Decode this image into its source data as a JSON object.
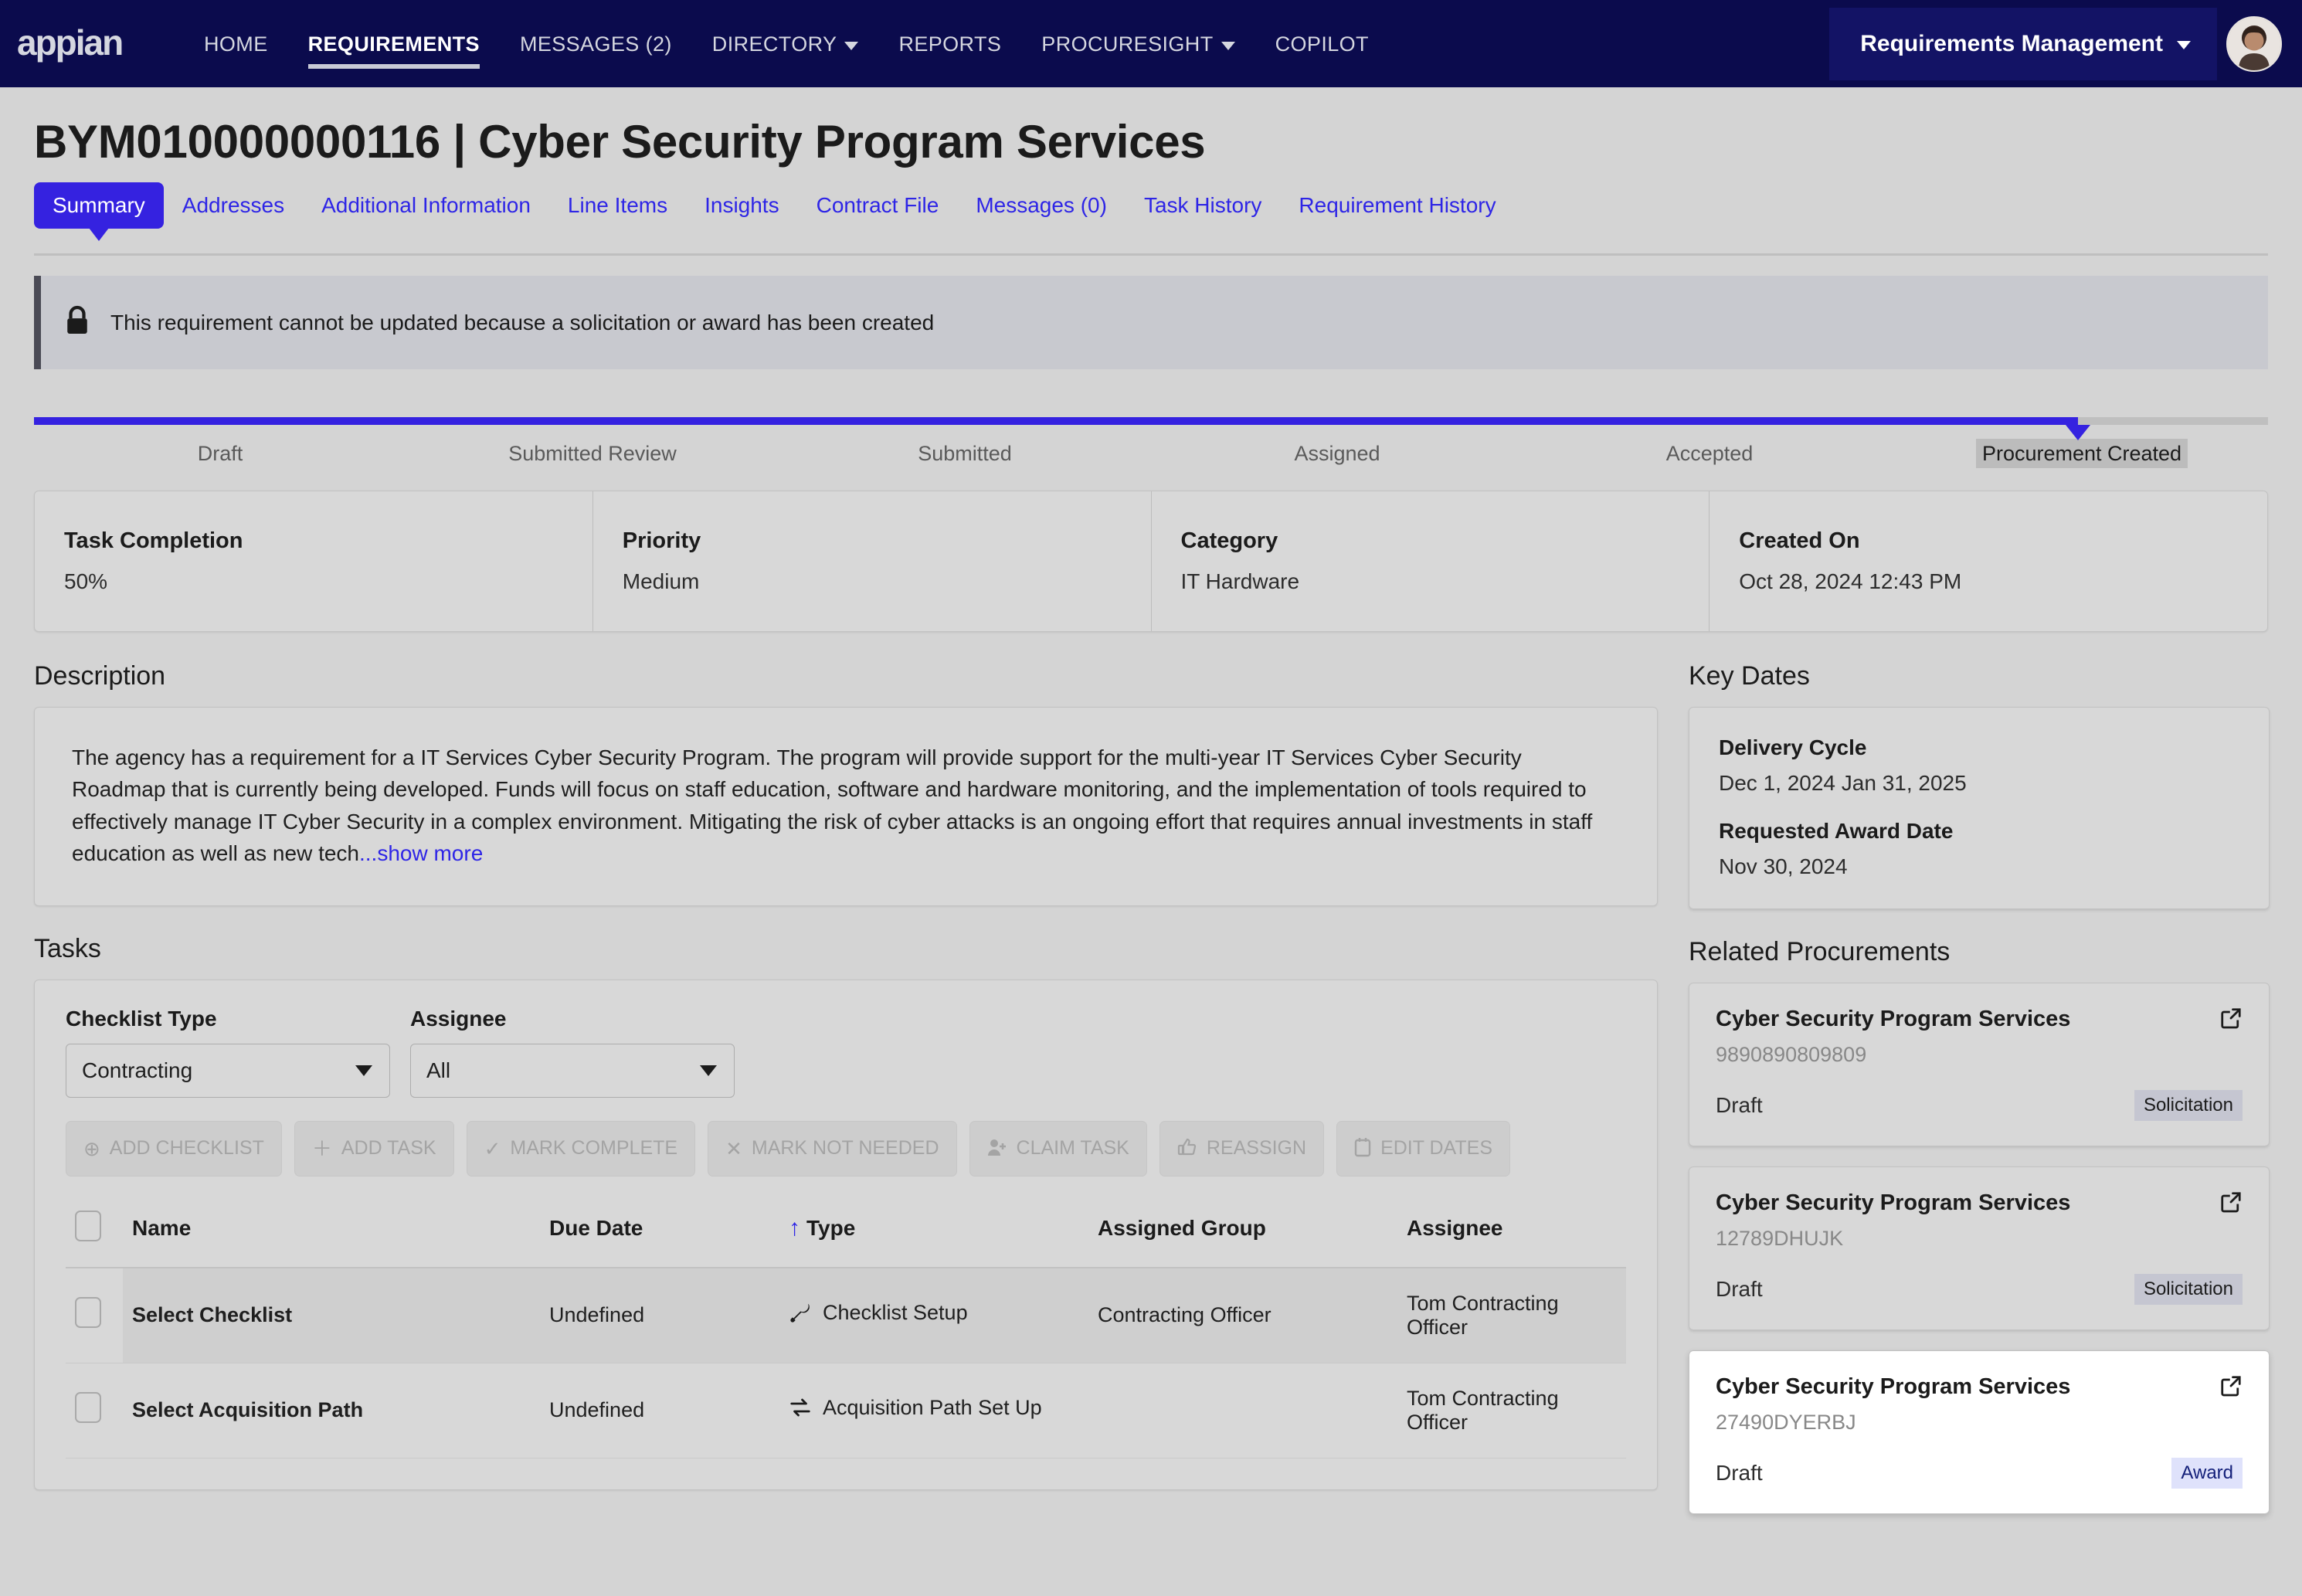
{
  "topnav": {
    "logo_alt": "appian",
    "items": [
      {
        "label": "HOME",
        "has_caret": false,
        "active": false
      },
      {
        "label": "REQUIREMENTS",
        "has_caret": false,
        "active": true
      },
      {
        "label": "MESSAGES (2)",
        "has_caret": false,
        "active": false
      },
      {
        "label": "DIRECTORY",
        "has_caret": true,
        "active": false
      },
      {
        "label": "REPORTS",
        "has_caret": false,
        "active": false
      },
      {
        "label": "PROCURESIGHT",
        "has_caret": true,
        "active": false
      },
      {
        "label": "COPILOT",
        "has_caret": false,
        "active": false
      }
    ],
    "app_switcher": "Requirements Management"
  },
  "page": {
    "title": "BYM010000000116 | Cyber Security Program Services"
  },
  "tabs": [
    {
      "label": "Summary",
      "active": true
    },
    {
      "label": "Addresses",
      "active": false
    },
    {
      "label": "Additional Information",
      "active": false
    },
    {
      "label": "Line Items",
      "active": false
    },
    {
      "label": "Insights",
      "active": false
    },
    {
      "label": "Contract File",
      "active": false
    },
    {
      "label": "Messages (0)",
      "active": false
    },
    {
      "label": "Task History",
      "active": false
    },
    {
      "label": "Requirement History",
      "active": false
    }
  ],
  "alert": {
    "icon": "lock-icon",
    "message": "This requirement cannot be updated because a solicitation or award has been created"
  },
  "progress": {
    "steps": [
      "Draft",
      "Submitted Review",
      "Submitted",
      "Assigned",
      "Accepted",
      "Procurement Created"
    ],
    "current_index": 5,
    "fill_percent": 91.5,
    "accent": "#3522e0"
  },
  "stats": [
    {
      "label": "Task Completion",
      "value": "50%"
    },
    {
      "label": "Priority",
      "value": "Medium"
    },
    {
      "label": "Category",
      "value": "IT Hardware"
    },
    {
      "label": "Created On",
      "value": "Oct 28, 2024 12:43 PM"
    }
  ],
  "description": {
    "heading": "Description",
    "body": "The agency has a requirement for a IT Services Cyber Security Program. The program will provide support for the multi-year IT Services Cyber Security Roadmap that is currently being developed. Funds will focus on staff education, software and hardware monitoring, and the implementation of tools required to effectively manage IT Cyber Security in a complex environment. Mitigating the risk of cyber attacks is an ongoing effort that requires annual investments in staff education as well as new tech",
    "show_more": "...show more"
  },
  "tasks": {
    "heading": "Tasks",
    "checklist_type": {
      "label": "Checklist Type",
      "value": "Contracting"
    },
    "assignee_filter": {
      "label": "Assignee",
      "value": "All"
    },
    "buttons": [
      {
        "label": "ADD CHECKLIST",
        "icon": "plus-circle-icon",
        "glyph": "⊕"
      },
      {
        "label": "ADD TASK",
        "icon": "plus-icon",
        "glyph": "＋"
      },
      {
        "label": "MARK COMPLETE",
        "icon": "check-icon",
        "glyph": "✓"
      },
      {
        "label": "MARK NOT NEEDED",
        "icon": "x-icon",
        "glyph": "✕"
      },
      {
        "label": "CLAIM TASK",
        "icon": "user-plus-icon",
        "glyph": "⚬"
      },
      {
        "label": "REASSIGN",
        "icon": "thumbs-up-icon",
        "glyph": "☝"
      },
      {
        "label": "EDIT DATES",
        "icon": "calendar-icon",
        "glyph": "▢"
      }
    ],
    "columns": [
      "Name",
      "Due Date",
      "Type",
      "Assigned Group",
      "Assignee"
    ],
    "sorted_column": "Type",
    "sort_direction": "asc",
    "rows": [
      {
        "name": "Select Checklist",
        "due_date": "Undefined",
        "type": "Checklist Setup",
        "type_icon": "wrench-icon",
        "assigned_group": "Contracting Officer",
        "assignee": "Tom Contracting Officer",
        "hover": true
      },
      {
        "name": "Select Acquisition Path",
        "due_date": "Undefined",
        "type": "Acquisition Path Set Up",
        "type_icon": "swap-arrows-icon",
        "assigned_group": "",
        "assignee": "Tom Contracting Officer",
        "hover": false
      }
    ]
  },
  "key_dates": {
    "heading": "Key Dates",
    "blocks": [
      {
        "label": "Delivery Cycle",
        "value": "Dec 1, 2024  Jan 31, 2025"
      },
      {
        "label": "Requested Award Date",
        "value": "Nov 30, 2024"
      }
    ]
  },
  "related_procurements": {
    "heading": "Related Procurements",
    "cards": [
      {
        "title": "Cyber Security Program Services",
        "id": "9890890809809",
        "status": "Draft",
        "badge": "Solicitation",
        "badge_kind": "solicitation",
        "hover": false
      },
      {
        "title": "Cyber Security Program Services",
        "id": "12789DHUJK",
        "status": "Draft",
        "badge": "Solicitation",
        "badge_kind": "solicitation",
        "hover": false
      },
      {
        "title": "Cyber Security Program Services",
        "id": "27490DYERBJ",
        "status": "Draft",
        "badge": "Award",
        "badge_kind": "award",
        "hover": true
      }
    ]
  },
  "colors": {
    "nav_bg": "#0b0b4d",
    "accent_blue": "#3522e0",
    "link_blue": "#2e25e6",
    "page_bg": "#d4d4d4",
    "panel_bg": "#d8d8d8",
    "award_badge_bg": "#dfe2fb",
    "solicitation_badge_bg": "#c5c6d1"
  }
}
